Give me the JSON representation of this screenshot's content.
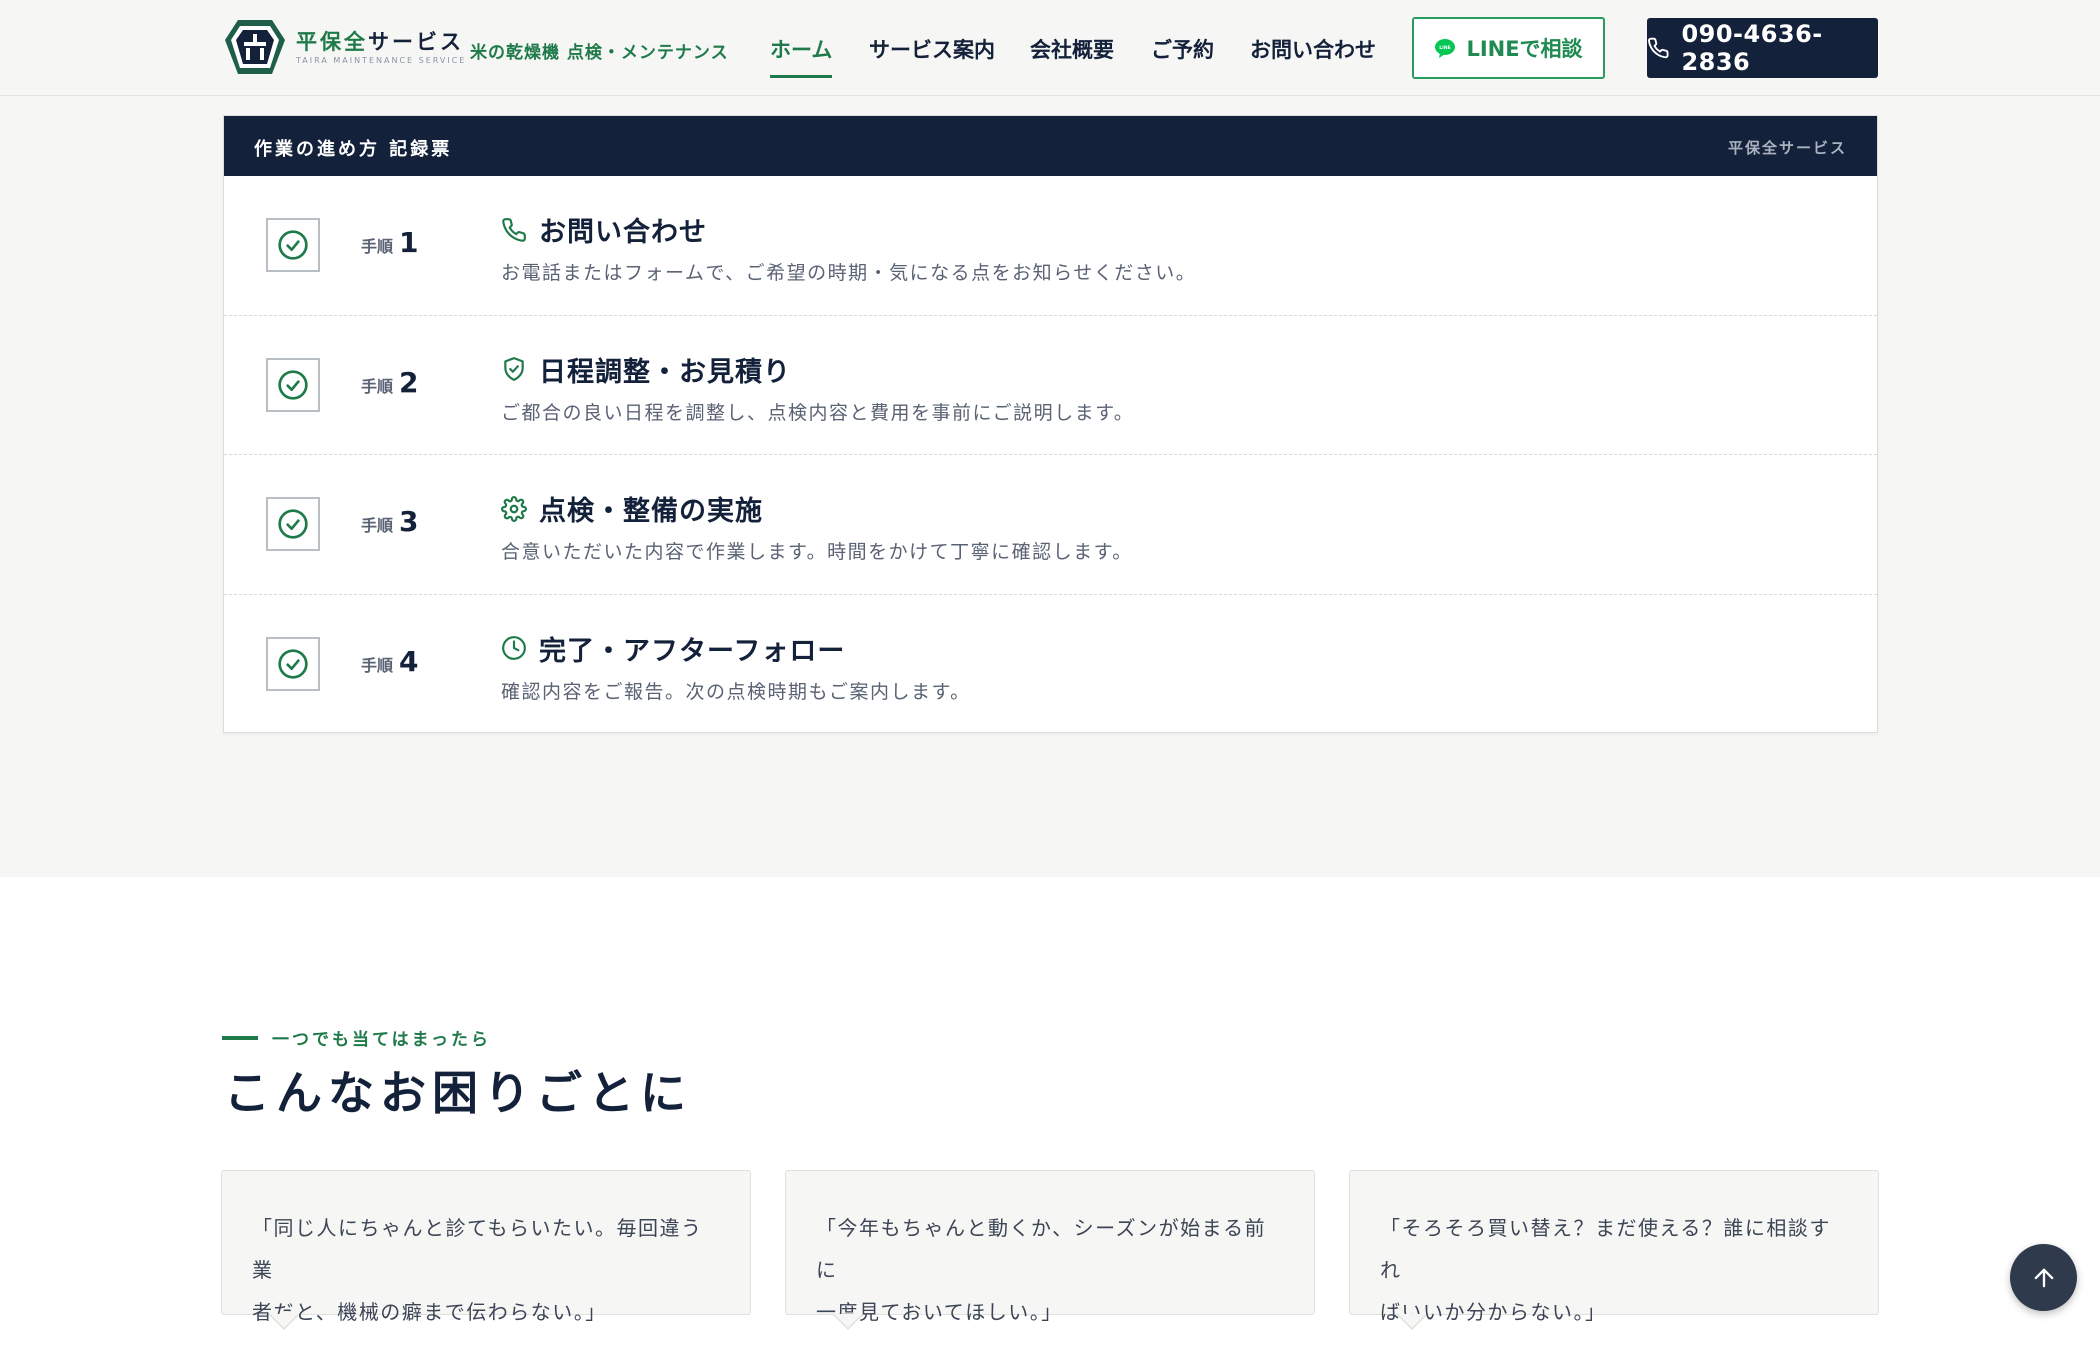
{
  "header": {
    "logo_name_a": "平保全",
    "logo_name_b": "サービス",
    "logo_sub": "TAIRA MAINTENANCE SERVICE",
    "tagline": "米の乾燥機 点検・メンテナンス",
    "nav": [
      {
        "label": "ホーム",
        "active": true
      },
      {
        "label": "サービス案内"
      },
      {
        "label": "会社概要"
      },
      {
        "label": "ご予約"
      },
      {
        "label": "お問い合わせ"
      }
    ],
    "line_button": "LINEで相談",
    "line_icon_text": "LINE",
    "tel_button": "090-4636-2836"
  },
  "record": {
    "title": "作業の進め方 記録票",
    "brand": "平保全サービス",
    "step_label": "手順",
    "steps": [
      {
        "num": "1",
        "icon": "phone-icon",
        "title": "お問い合わせ",
        "desc": "お電話またはフォームで、ご希望の時期・気になる点をお知らせください。"
      },
      {
        "num": "2",
        "icon": "shield-check-icon",
        "title": "日程調整・お見積り",
        "desc": "ご都合の良い日程を調整し、点検内容と費用を事前にご説明します。"
      },
      {
        "num": "3",
        "icon": "gear-icon",
        "title": "点検・整備の実施",
        "desc": "合意いただいた内容で作業します。時間をかけて丁寧に確認します。"
      },
      {
        "num": "4",
        "icon": "clock-icon",
        "title": "完了・アフターフォロー",
        "desc": "確認内容をご報告。次の点検時期もご案内します。"
      }
    ]
  },
  "troubles": {
    "eyebrow": "一つでも当てはまったら",
    "title": "こんなお困りごとに",
    "quotes": [
      {
        "line1": "「同じ人にちゃんと診てもらいたい。毎回違う業",
        "line2": "者だと、機械の癖まで伝わらない。」"
      },
      {
        "line1": "「今年もちゃんと動くか、シーズンが始まる前に",
        "line2": "一度見ておいてほしい。」"
      },
      {
        "line1": "「そろそろ買い替え？まだ使える？誰に相談すれ",
        "line2": "ばいいか分からない。」"
      }
    ]
  },
  "colors": {
    "navy": "#14213a",
    "green": "#1f7a4a",
    "line_green": "#06c755"
  }
}
